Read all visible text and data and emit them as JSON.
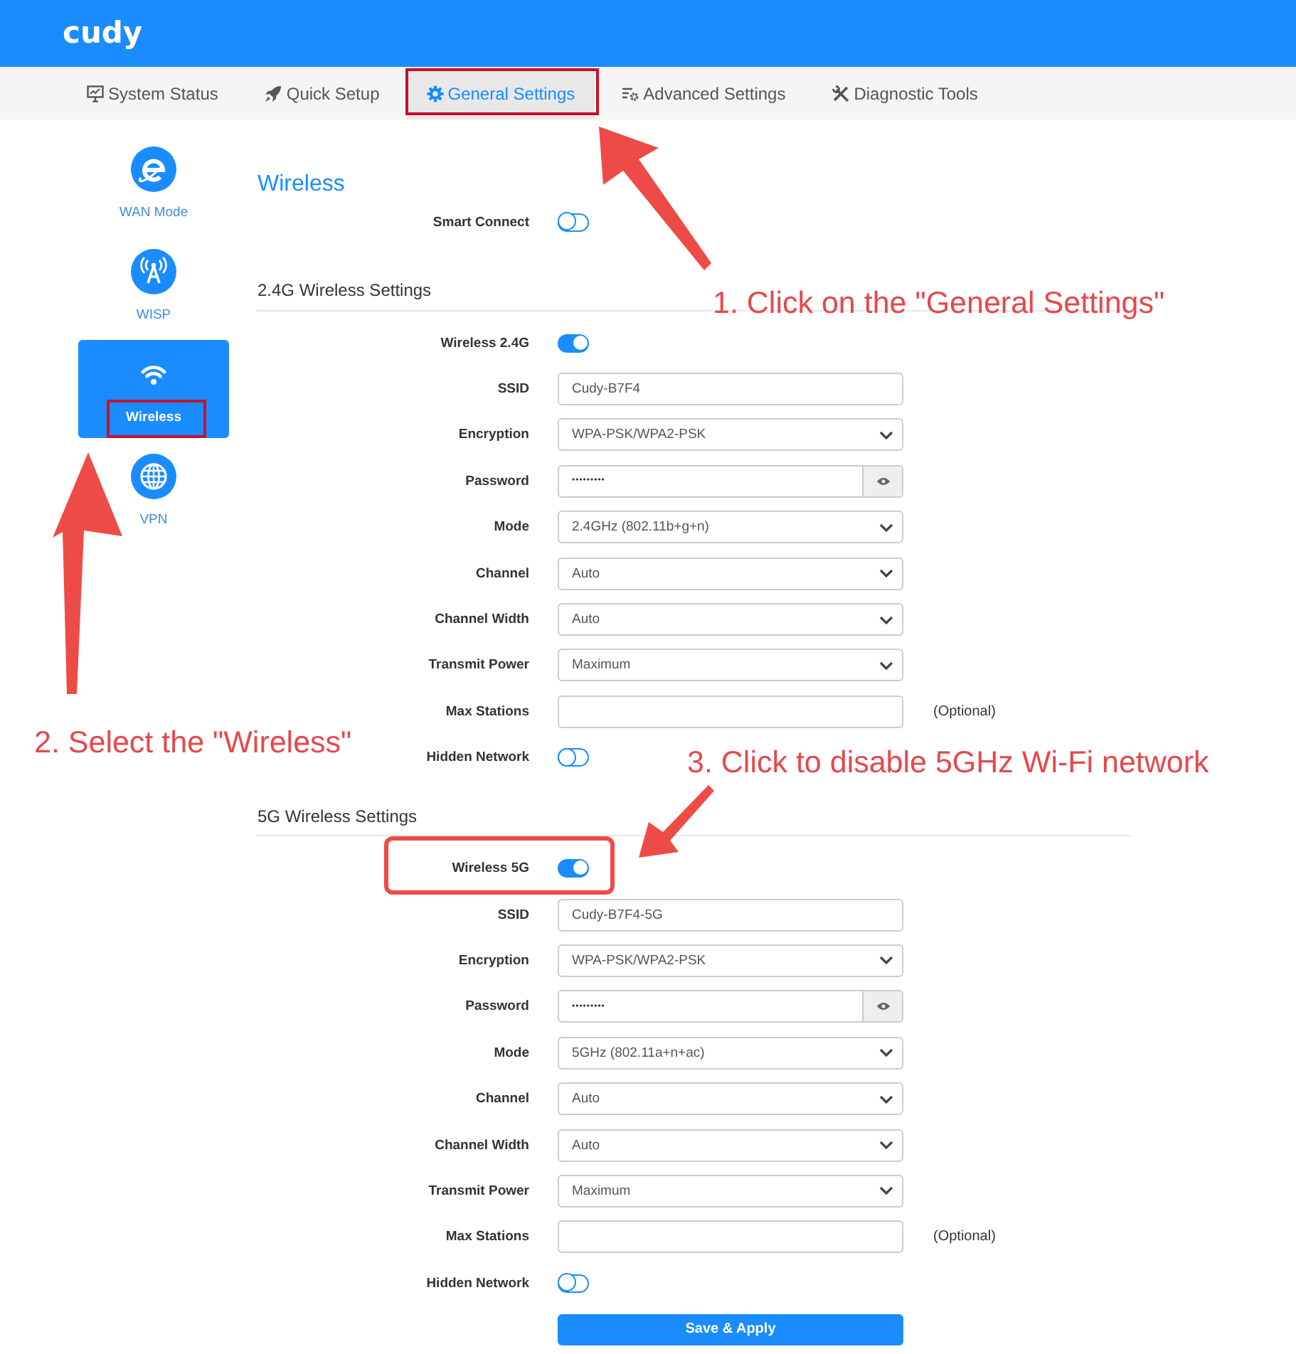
{
  "header": {
    "logo": "cudy"
  },
  "nav": {
    "tabs": [
      {
        "label": "System Status",
        "selected": false,
        "highlighted": false
      },
      {
        "label": "Quick Setup",
        "selected": false,
        "highlighted": false
      },
      {
        "label": "General Settings",
        "selected": true,
        "highlighted": true
      },
      {
        "label": "Advanced Settings",
        "selected": false,
        "highlighted": false
      },
      {
        "label": "Diagnostic Tools",
        "selected": false,
        "highlighted": false
      }
    ]
  },
  "sidebar": {
    "items": [
      {
        "label": "WAN Mode",
        "selected": false,
        "highlighted": false
      },
      {
        "label": "WISP",
        "selected": false,
        "highlighted": false
      },
      {
        "label": "Wireless",
        "selected": true,
        "highlighted": true
      },
      {
        "label": "VPN",
        "selected": false,
        "highlighted": false
      }
    ]
  },
  "page_title": "Wireless",
  "smart_connect": {
    "label": "Smart Connect",
    "on": false
  },
  "sections": [
    {
      "title": "2.4G Wireless Settings",
      "rows": [
        {
          "kind": "toggle",
          "label": "Wireless 2.4G",
          "on": true,
          "highlighted": false
        },
        {
          "kind": "text",
          "label": "SSID",
          "value": "Cudy-B7F4",
          "highlighted": false
        },
        {
          "kind": "select",
          "label": "Encryption",
          "value": "WPA-PSK/WPA2-PSK",
          "highlighted": false
        },
        {
          "kind": "password",
          "label": "Password",
          "value": "•••••••••",
          "highlighted": false
        },
        {
          "kind": "select",
          "label": "Mode",
          "value": "2.4GHz (802.11b+g+n)",
          "highlighted": false
        },
        {
          "kind": "select",
          "label": "Channel",
          "value": "Auto",
          "highlighted": false
        },
        {
          "kind": "select",
          "label": "Channel Width",
          "value": "Auto",
          "highlighted": false
        },
        {
          "kind": "select",
          "label": "Transmit Power",
          "value": "Maximum",
          "highlighted": false
        },
        {
          "kind": "text",
          "label": "Max Stations",
          "note": "(Optional)",
          "highlighted": false
        },
        {
          "kind": "toggle",
          "label": "Hidden Network",
          "on": false,
          "highlighted": false
        }
      ]
    },
    {
      "title": "5G Wireless Settings",
      "rows": [
        {
          "kind": "toggle",
          "label": "Wireless 5G",
          "on": true,
          "highlighted": true
        },
        {
          "kind": "text",
          "label": "SSID",
          "value": "Cudy-B7F4-5G",
          "highlighted": false
        },
        {
          "kind": "select",
          "label": "Encryption",
          "value": "WPA-PSK/WPA2-PSK",
          "highlighted": false
        },
        {
          "kind": "password",
          "label": "Password",
          "value": "•••••••••",
          "highlighted": false
        },
        {
          "kind": "select",
          "label": "Mode",
          "value": "5GHz (802.11a+n+ac)",
          "highlighted": false
        },
        {
          "kind": "select",
          "label": "Channel",
          "value": "Auto",
          "highlighted": false
        },
        {
          "kind": "select",
          "label": "Channel Width",
          "value": "Auto",
          "highlighted": false
        },
        {
          "kind": "select",
          "label": "Transmit Power",
          "value": "Maximum",
          "highlighted": false
        },
        {
          "kind": "text",
          "label": "Max Stations",
          "note": "(Optional)",
          "highlighted": false
        },
        {
          "kind": "toggle",
          "label": "Hidden Network",
          "on": false,
          "highlighted": false
        }
      ]
    }
  ],
  "save_button": "Save & Apply",
  "annotations": [
    {
      "text": "1. Click on the \"General Settings\""
    },
    {
      "text": "2. Select the \"Wireless\""
    },
    {
      "text": "3. Click to disable 5GHz Wi-Fi network"
    }
  ]
}
